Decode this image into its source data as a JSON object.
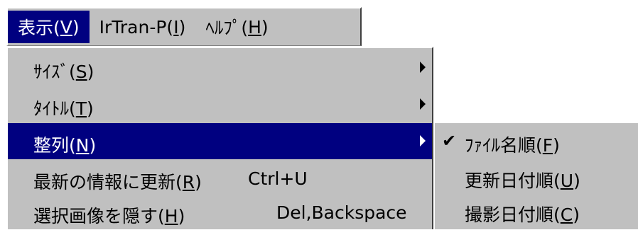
{
  "menubar": {
    "items": [
      {
        "text": "表示(",
        "key": "V",
        "suffix": ")"
      },
      {
        "text": "IrTran-P(",
        "key": "I",
        "suffix": ")"
      },
      {
        "text": "ﾍﾙﾌﾟ(",
        "key": "H",
        "suffix": ")"
      }
    ]
  },
  "view_menu": {
    "items": [
      {
        "text": "ｻｲｽﾞ(",
        "key": "S",
        "suffix": ")",
        "shortcut": ""
      },
      {
        "text": "ﾀｲﾄﾙ(",
        "key": "T",
        "suffix": ")",
        "shortcut": ""
      },
      {
        "text": "整列(",
        "key": "N",
        "suffix": ")",
        "shortcut": ""
      },
      {
        "text": "最新の情報に更新(",
        "key": "R",
        "suffix": ")",
        "shortcut": "Ctrl+U"
      },
      {
        "text": "選択画像を隠す(",
        "key": "H",
        "suffix": ")",
        "shortcut": "Del,Backspace"
      }
    ]
  },
  "sort_submenu": {
    "items": [
      {
        "text": "ﾌｧｲﾙ名順(",
        "key": "F",
        "suffix": ")",
        "checked": true
      },
      {
        "text": "更新日付順(",
        "key": "U",
        "suffix": ")",
        "checked": false
      },
      {
        "text": "撮影日付順(",
        "key": "C",
        "suffix": ")",
        "checked": false
      }
    ]
  },
  "icons": {
    "check": "✔",
    "submenu_arrow": "submenu-arrow-icon"
  },
  "colors": {
    "menu_bg": "#c0c0c0",
    "highlight": "#000080",
    "highlight_text": "#ffffff"
  }
}
